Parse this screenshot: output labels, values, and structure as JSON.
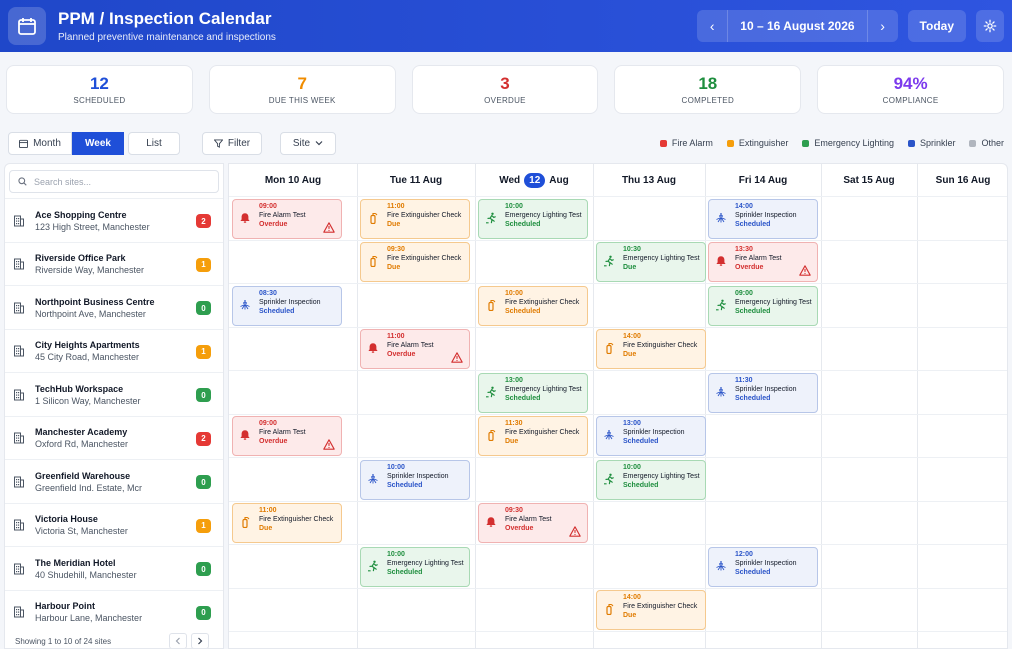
{
  "header": {
    "title": "PPM / Inspection Calendar",
    "subtitle": "Planned preventive maintenance and inspections",
    "date_range": "10 – 16 August 2026",
    "prev": "‹",
    "next": "›",
    "today": "Today"
  },
  "stats": [
    {
      "value": "12",
      "label": "SCHEDULED",
      "color": "#1f4fd8"
    },
    {
      "value": "7",
      "label": "DUE THIS WEEK",
      "color": "#f08c00"
    },
    {
      "value": "3",
      "label": "OVERDUE",
      "color": "#d32f2f"
    },
    {
      "value": "18",
      "label": "COMPLETED",
      "color": "#1e8e3e"
    },
    {
      "value": "94%",
      "label": "COMPLIANCE",
      "color": "#7c3aed"
    }
  ],
  "toolbar": {
    "month": "Month",
    "week": "Week",
    "list": "List",
    "filter": "Filter",
    "site": "Site"
  },
  "legend": [
    {
      "label": "Fire Alarm",
      "color": "#e53935"
    },
    {
      "label": "Extinguisher",
      "color": "#f59e0b"
    },
    {
      "label": "Emergency Lighting",
      "color": "#2e9e4f"
    },
    {
      "label": "Sprinkler",
      "color": "#2a54c8"
    },
    {
      "label": "Other",
      "color": "#b0b5be"
    }
  ],
  "search": {
    "placeholder": "Search sites..."
  },
  "sites": [
    {
      "name": "Ace Shopping Centre",
      "address": "123 High Street, Manchester",
      "count": "2",
      "color": "#e53935"
    },
    {
      "name": "Riverside Office Park",
      "address": "Riverside Way, Manchester",
      "count": "1",
      "color": "#f59e0b"
    },
    {
      "name": "Northpoint Business Centre",
      "address": "Northpoint Ave, Manchester",
      "count": "0",
      "color": "#2e9e4f"
    },
    {
      "name": "City Heights Apartments",
      "address": "45 City Road, Manchester",
      "count": "1",
      "color": "#f59e0b"
    },
    {
      "name": "TechHub Workspace",
      "address": "1 Silicon Way, Manchester",
      "count": "0",
      "color": "#2e9e4f"
    },
    {
      "name": "Manchester Academy",
      "address": "Oxford Rd, Manchester",
      "count": "2",
      "color": "#e53935"
    },
    {
      "name": "Greenfield Warehouse",
      "address": "Greenfield Ind. Estate, Mcr",
      "count": "0",
      "color": "#2e9e4f"
    },
    {
      "name": "Victoria House",
      "address": "Victoria St, Manchester",
      "count": "1",
      "color": "#f59e0b"
    },
    {
      "name": "The Meridian Hotel",
      "address": "40 Shudehill, Manchester",
      "count": "0",
      "color": "#2e9e4f"
    },
    {
      "name": "Harbour Point",
      "address": "Harbour Lane, Manchester",
      "count": "0",
      "color": "#2e9e4f"
    }
  ],
  "footer": {
    "showing": "Showing 1 to 10 of 24 sites"
  },
  "days": [
    {
      "label": "Mon 10 Aug"
    },
    {
      "label": "Tue 11 Aug"
    },
    {
      "pre": "Wed",
      "num": "12",
      "post": "Aug"
    },
    {
      "label": "Thu 13 Aug"
    },
    {
      "label": "Fri 14 Aug"
    },
    {
      "label": "Sat 15 Aug"
    },
    {
      "label": "Sun 16 Aug"
    }
  ],
  "events": [
    {
      "row": 0,
      "day": 0,
      "type": "fire",
      "time": "09:00",
      "name": "Fire Alarm Test",
      "status": "Overdue",
      "warn": true
    },
    {
      "row": 0,
      "day": 1,
      "type": "ext",
      "time": "11:00",
      "name": "Fire Extinguisher Check",
      "status": "Due"
    },
    {
      "row": 0,
      "day": 2,
      "type": "emg",
      "time": "10:00",
      "name": "Emergency Lighting Test",
      "status": "Scheduled"
    },
    {
      "row": 0,
      "day": 4,
      "type": "spr",
      "time": "14:00",
      "name": "Sprinkler Inspection",
      "status": "Scheduled"
    },
    {
      "row": 1,
      "day": 1,
      "type": "ext",
      "time": "09:30",
      "name": "Fire Extinguisher Check",
      "status": "Due"
    },
    {
      "row": 1,
      "day": 3,
      "type": "emg",
      "time": "10:30",
      "name": "Emergency Lighting Test",
      "status": "Due"
    },
    {
      "row": 1,
      "day": 4,
      "type": "fire",
      "time": "13:30",
      "name": "Fire Alarm Test",
      "status": "Overdue",
      "warn": true
    },
    {
      "row": 2,
      "day": 0,
      "type": "spr",
      "time": "08:30",
      "name": "Sprinkler Inspection",
      "status": "Scheduled"
    },
    {
      "row": 2,
      "day": 2,
      "type": "ext",
      "time": "10:00",
      "name": "Fire Extinguisher Check",
      "status": "Scheduled"
    },
    {
      "row": 2,
      "day": 4,
      "type": "emg",
      "time": "09:00",
      "name": "Emergency Lighting Test",
      "status": "Scheduled"
    },
    {
      "row": 3,
      "day": 1,
      "type": "fire",
      "time": "11:00",
      "name": "Fire Alarm Test",
      "status": "Overdue",
      "warn": true
    },
    {
      "row": 3,
      "day": 3,
      "type": "ext",
      "time": "14:00",
      "name": "Fire Extinguisher Check",
      "status": "Due"
    },
    {
      "row": 4,
      "day": 2,
      "type": "emg",
      "time": "13:00",
      "name": "Emergency Lighting Test",
      "status": "Scheduled"
    },
    {
      "row": 4,
      "day": 4,
      "type": "spr",
      "time": "11:30",
      "name": "Sprinkler Inspection",
      "status": "Scheduled"
    },
    {
      "row": 5,
      "day": 0,
      "type": "fire",
      "time": "09:00",
      "name": "Fire Alarm Test",
      "status": "Overdue",
      "warn": true
    },
    {
      "row": 5,
      "day": 2,
      "type": "ext",
      "time": "11:30",
      "name": "Fire Extinguisher Check",
      "status": "Due"
    },
    {
      "row": 5,
      "day": 3,
      "type": "spr",
      "time": "13:00",
      "name": "Sprinkler Inspection",
      "status": "Scheduled"
    },
    {
      "row": 6,
      "day": 1,
      "type": "spr",
      "time": "10:00",
      "name": "Sprinkler Inspection",
      "status": "Scheduled"
    },
    {
      "row": 6,
      "day": 3,
      "type": "emg",
      "time": "10:00",
      "name": "Emergency Lighting Test",
      "status": "Scheduled"
    },
    {
      "row": 7,
      "day": 0,
      "type": "ext",
      "time": "11:00",
      "name": "Fire Extinguisher Check",
      "status": "Due"
    },
    {
      "row": 7,
      "day": 2,
      "type": "fire",
      "time": "09:30",
      "name": "Fire Alarm Test",
      "status": "Overdue",
      "warn": true
    },
    {
      "row": 8,
      "day": 1,
      "type": "emg",
      "time": "10:00",
      "name": "Emergency Lighting Test",
      "status": "Scheduled"
    },
    {
      "row": 8,
      "day": 4,
      "type": "spr",
      "time": "12:00",
      "name": "Sprinkler Inspection",
      "status": "Scheduled"
    },
    {
      "row": 9,
      "day": 3,
      "type": "ext",
      "time": "14:00",
      "name": "Fire Extinguisher Check",
      "status": "Due"
    }
  ]
}
